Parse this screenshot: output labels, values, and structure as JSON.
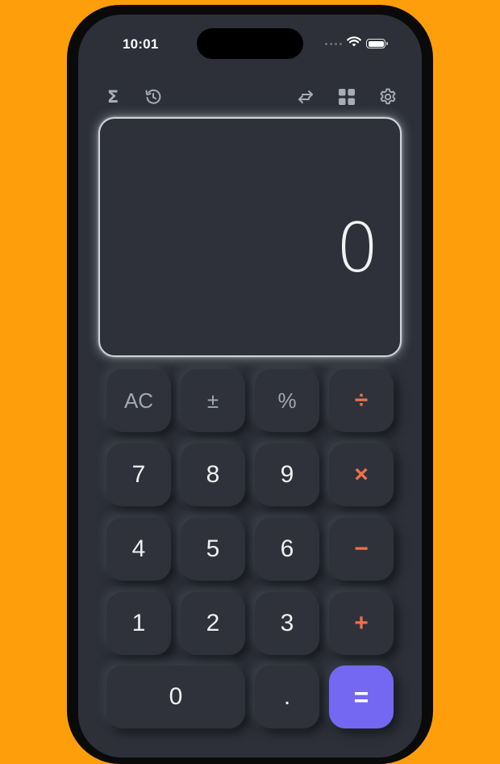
{
  "status_bar": {
    "time": "10:01"
  },
  "toolbar": {
    "left_icons": [
      "sigma-icon",
      "history-icon"
    ],
    "right_icons": [
      "swap-icon",
      "grid-icon",
      "settings-icon"
    ],
    "sigma_glyph": "Σ"
  },
  "display": {
    "value": "0"
  },
  "keypad": {
    "ac": "AC",
    "plus_minus": "±",
    "percent": "%",
    "divide": "÷",
    "seven": "7",
    "eight": "8",
    "nine": "9",
    "multiply": "×",
    "four": "4",
    "five": "5",
    "six": "6",
    "minus": "−",
    "one": "1",
    "two": "2",
    "three": "3",
    "plus": "+",
    "zero": "0",
    "decimal": ".",
    "equals": "="
  },
  "colors": {
    "background": "#FF9E0B",
    "screen": "#2D3039",
    "operator": "#F0704A",
    "equals_button": "#7468F2"
  }
}
